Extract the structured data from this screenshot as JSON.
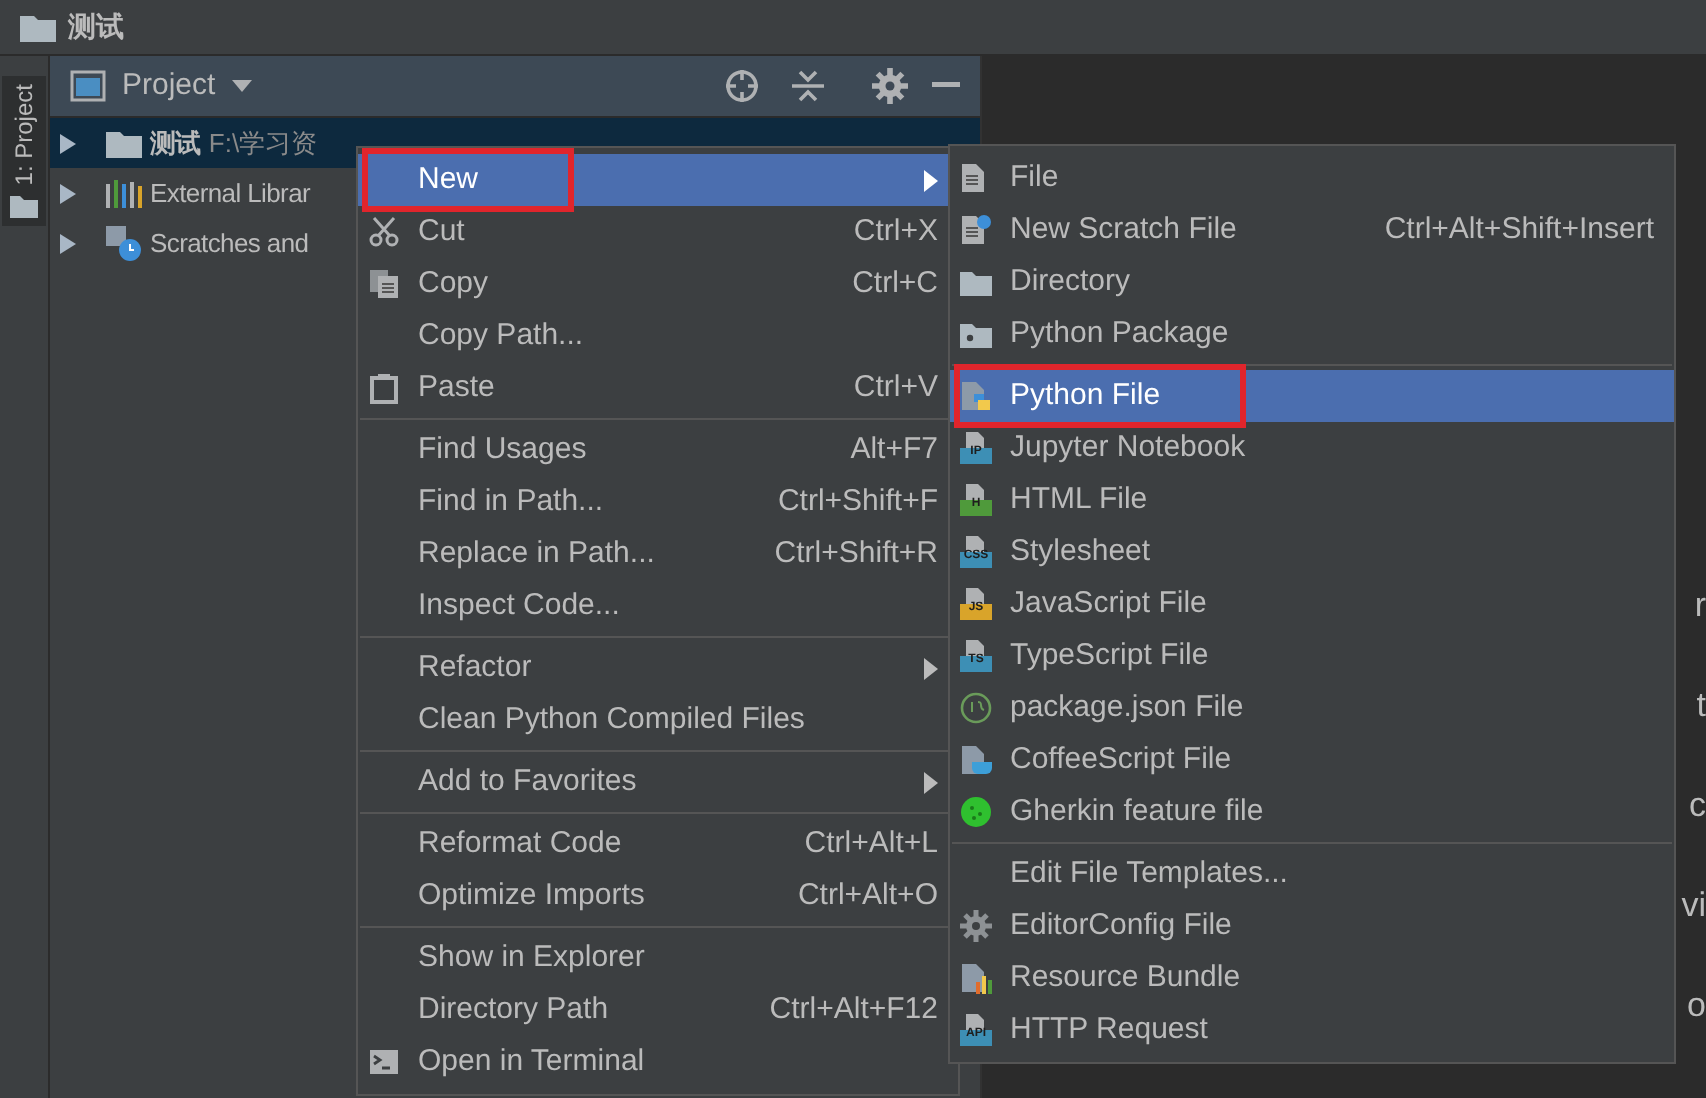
{
  "window": {
    "title": "测试"
  },
  "side_strip": {
    "tab": "1: Project"
  },
  "project_panel": {
    "title": "Project",
    "tree": [
      {
        "name": "测试",
        "path": "F:\\学习资",
        "expanded": false,
        "selected": true
      },
      {
        "name": "External Librar",
        "expanded": false,
        "selected": false
      },
      {
        "name": "Scratches and",
        "expanded": false,
        "selected": false
      }
    ]
  },
  "editor": {
    "fragments": [
      "r",
      "t",
      "c",
      "vi",
      "o"
    ]
  },
  "context_menu": {
    "items": [
      {
        "kind": "item",
        "label": "New",
        "submenu": true,
        "selected": true,
        "annotated": true
      },
      {
        "kind": "item",
        "label": "Cut",
        "shortcut": "Ctrl+X",
        "selected": false
      },
      {
        "kind": "item",
        "label": "Copy",
        "shortcut": "Ctrl+C",
        "selected": false
      },
      {
        "kind": "item",
        "label": "Copy Path...",
        "selected": false
      },
      {
        "kind": "item",
        "label": "Paste",
        "shortcut": "Ctrl+V",
        "selected": false
      },
      {
        "kind": "separator"
      },
      {
        "kind": "item",
        "label": "Find Usages",
        "shortcut": "Alt+F7",
        "selected": false
      },
      {
        "kind": "item",
        "label": "Find in Path...",
        "shortcut": "Ctrl+Shift+F",
        "selected": false
      },
      {
        "kind": "item",
        "label": "Replace in Path...",
        "shortcut": "Ctrl+Shift+R",
        "selected": false
      },
      {
        "kind": "item",
        "label": "Inspect Code...",
        "selected": false
      },
      {
        "kind": "separator"
      },
      {
        "kind": "item",
        "label": "Refactor",
        "submenu": true,
        "selected": false
      },
      {
        "kind": "item",
        "label": "Clean Python Compiled Files",
        "selected": false
      },
      {
        "kind": "separator"
      },
      {
        "kind": "item",
        "label": "Add to Favorites",
        "submenu": true,
        "selected": false
      },
      {
        "kind": "separator"
      },
      {
        "kind": "item",
        "label": "Reformat Code",
        "shortcut": "Ctrl+Alt+L",
        "selected": false
      },
      {
        "kind": "item",
        "label": "Optimize Imports",
        "shortcut": "Ctrl+Alt+O",
        "selected": false
      },
      {
        "kind": "separator"
      },
      {
        "kind": "item",
        "label": "Show in Explorer",
        "selected": false
      },
      {
        "kind": "item",
        "label": "Directory Path",
        "shortcut": "Ctrl+Alt+F12",
        "selected": false
      },
      {
        "kind": "item",
        "label": "Open in Terminal",
        "selected": false
      }
    ]
  },
  "new_submenu": {
    "items": [
      {
        "kind": "item",
        "label": "File",
        "selected": false
      },
      {
        "kind": "item",
        "label": "New Scratch File",
        "shortcut": "Ctrl+Alt+Shift+Insert",
        "selected": false
      },
      {
        "kind": "item",
        "label": "Directory",
        "selected": false
      },
      {
        "kind": "item",
        "label": "Python Package",
        "selected": false
      },
      {
        "kind": "separator"
      },
      {
        "kind": "item",
        "label": "Python File",
        "selected": true,
        "annotated": true
      },
      {
        "kind": "item",
        "label": "Jupyter Notebook",
        "icon_label": "IP",
        "color": "#3d8fb5",
        "selected": false
      },
      {
        "kind": "item",
        "label": "HTML File",
        "icon_label": "H",
        "color": "#4f9a3b",
        "selected": false
      },
      {
        "kind": "item",
        "label": "Stylesheet",
        "icon_label": "CSS",
        "color": "#3d8fb5",
        "selected": false
      },
      {
        "kind": "item",
        "label": "JavaScript File",
        "icon_label": "JS",
        "color": "#d9a42a",
        "selected": false
      },
      {
        "kind": "item",
        "label": "TypeScript File",
        "icon_label": "TS",
        "color": "#3d8fb5",
        "selected": false
      },
      {
        "kind": "item",
        "label": "package.json File",
        "selected": false
      },
      {
        "kind": "item",
        "label": "CoffeeScript File",
        "selected": false
      },
      {
        "kind": "item",
        "label": "Gherkin feature file",
        "selected": false
      },
      {
        "kind": "separator"
      },
      {
        "kind": "item",
        "label": "Edit File Templates...",
        "selected": false
      },
      {
        "kind": "item",
        "label": "EditorConfig File",
        "selected": false
      },
      {
        "kind": "item",
        "label": "Resource Bundle",
        "selected": false
      },
      {
        "kind": "item",
        "label": "HTTP Request",
        "icon_label": "API",
        "color": "#3d8fb5",
        "selected": false
      }
    ]
  }
}
